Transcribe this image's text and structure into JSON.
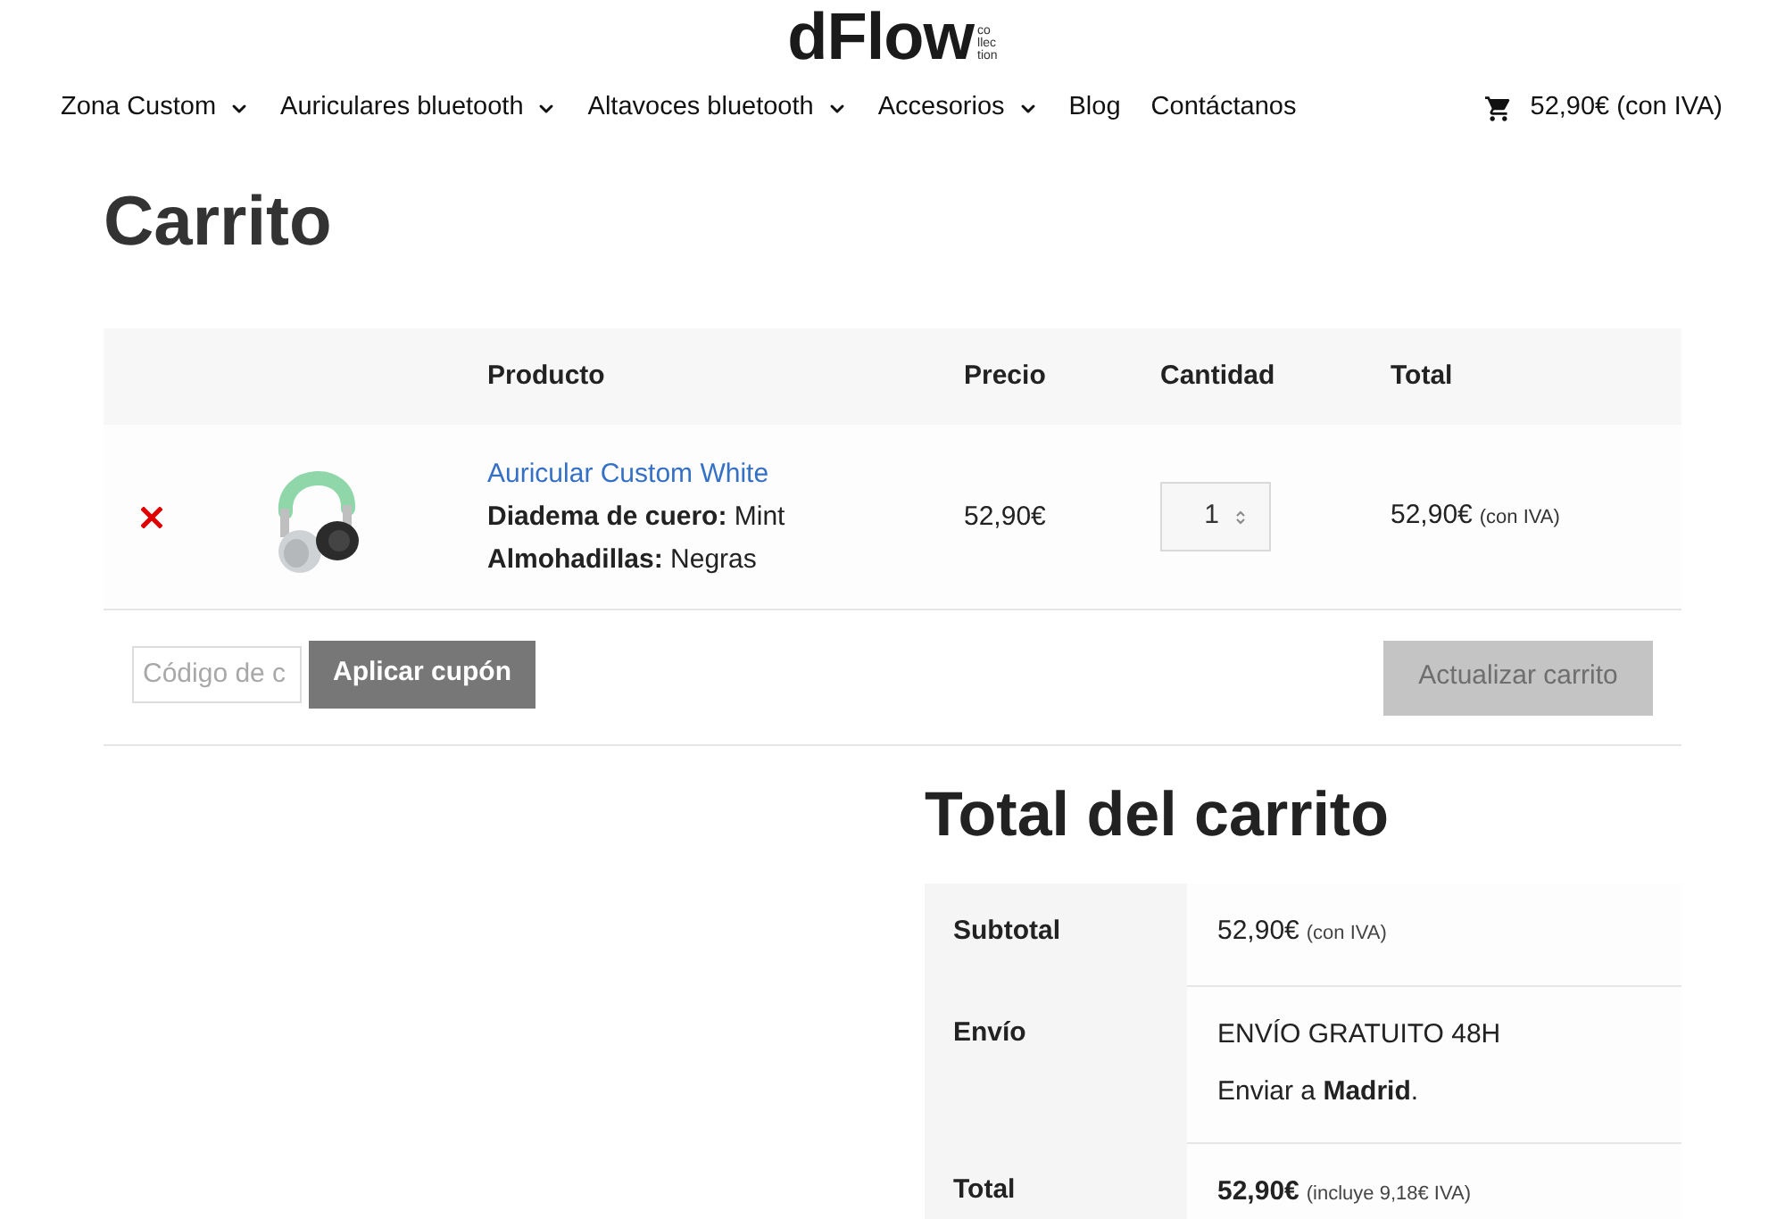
{
  "logo": {
    "wordmark": "dFlow",
    "tagline": [
      "co",
      "llec",
      "tion"
    ]
  },
  "nav": {
    "items": [
      {
        "label": "Zona Custom",
        "has_submenu": true
      },
      {
        "label": "Auriculares bluetooth",
        "has_submenu": true
      },
      {
        "label": "Altavoces bluetooth",
        "has_submenu": true
      },
      {
        "label": "Accesorios",
        "has_submenu": true
      },
      {
        "label": "Blog",
        "has_submenu": false
      },
      {
        "label": "Contáctanos",
        "has_submenu": false
      }
    ],
    "cart": {
      "label": "52,90€ (con IVA)"
    }
  },
  "page_title": "Carrito",
  "cart_table": {
    "columns": [
      "Producto",
      "Precio",
      "Cantidad",
      "Total"
    ],
    "rows": [
      {
        "product": "Auricular Custom White",
        "attributes": [
          "**Diadema de cuero:** Mint",
          "**Almohadillas:** Negras"
        ],
        "price": "52,90€",
        "quantity": "1",
        "total": "52,90€",
        "total_note": "(con IVA)"
      }
    ]
  },
  "coupon": {
    "placeholder": "Código de c",
    "button": "Aplicar cupón"
  },
  "update_button": {
    "label": "Actualizar carrito",
    "disabled": true
  },
  "cart_totals": {
    "title": "Total del carrito",
    "rows": [
      {
        "kind": "amount",
        "label": "Subtotal",
        "value": "52,90€",
        "note": "(con IVA)"
      },
      {
        "kind": "shipping",
        "label": "Envío",
        "lines": [
          "ENVÍO GRATUITO 48H",
          "Enviar a **Madrid**."
        ]
      },
      {
        "kind": "total",
        "label": "Total",
        "value": "52,90€",
        "note": "(incluye 9,18€ IVA)"
      }
    ]
  }
}
